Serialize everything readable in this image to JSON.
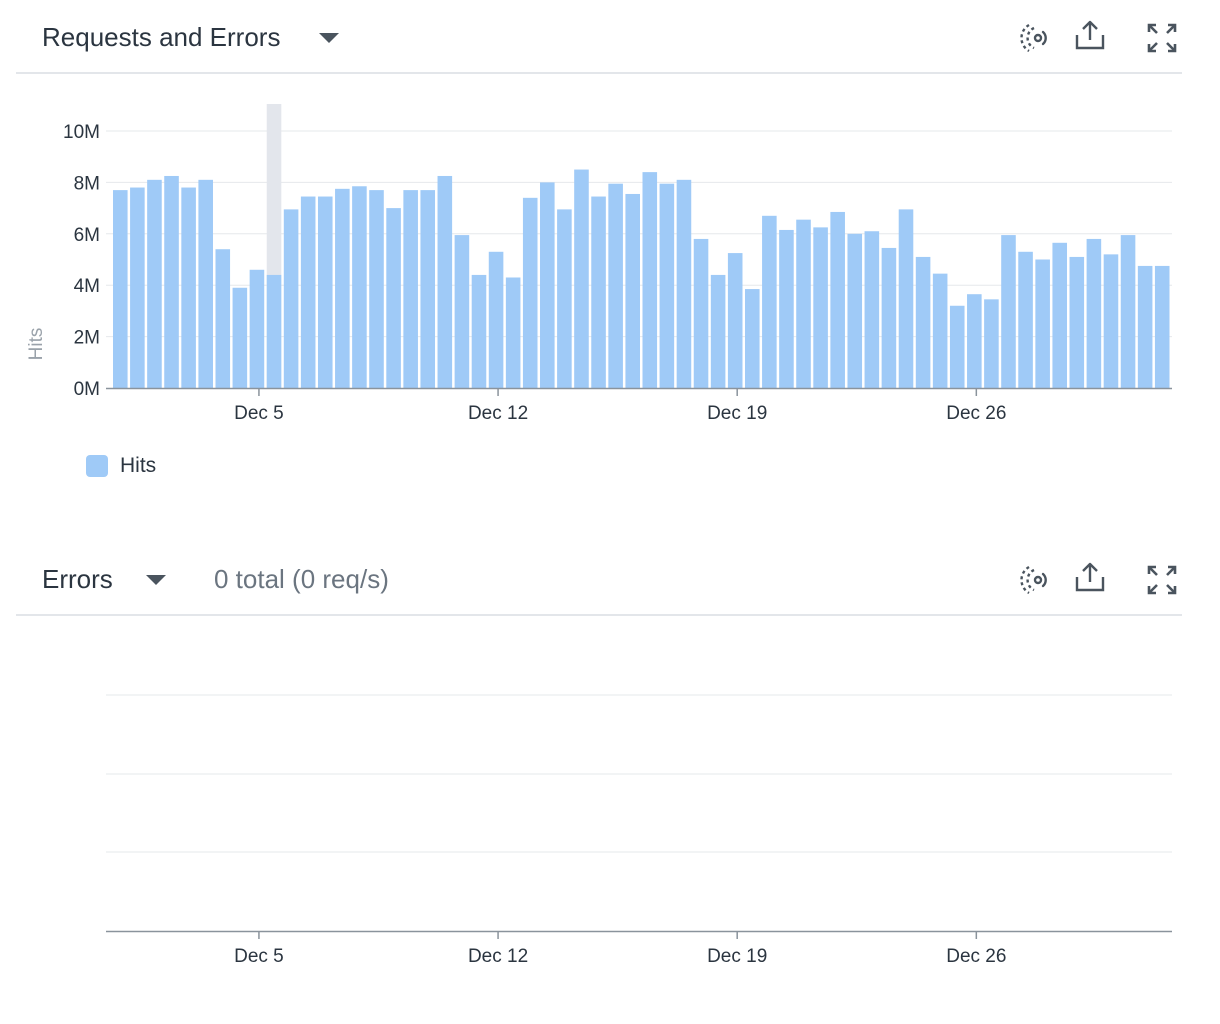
{
  "panels": {
    "requests": {
      "title": "Requests and Errors"
    },
    "errors": {
      "title": "Errors",
      "summary": "0 total (0 req/s)"
    }
  },
  "icons": {
    "live": "live-stream-icon",
    "export": "export-upload-icon",
    "expand": "expand-fullscreen-icon"
  },
  "colors": {
    "bar": "#9fcaf7",
    "highlight": "#e3e6ec",
    "grid": "#e6e8eb",
    "axis": "#8a939c"
  },
  "chart_data": [
    {
      "type": "bar",
      "ylabel": "Hits",
      "ylim": [
        0,
        10000000
      ],
      "y_ticks": [
        {
          "value": 0,
          "label": "0M"
        },
        {
          "value": 2000000,
          "label": "2M"
        },
        {
          "value": 4000000,
          "label": "4M"
        },
        {
          "value": 6000000,
          "label": "6M"
        },
        {
          "value": 8000000,
          "label": "8M"
        },
        {
          "value": 10000000,
          "label": "10M"
        }
      ],
      "x_ticks": [
        {
          "index": 8,
          "label": "Dec 5"
        },
        {
          "index": 22,
          "label": "Dec 12"
        },
        {
          "index": 36,
          "label": "Dec 19"
        },
        {
          "index": 50,
          "label": "Dec 26"
        }
      ],
      "legend": [
        {
          "name": "Hits",
          "color": "#9fcaf7"
        }
      ],
      "highlight_index": 9,
      "series": [
        {
          "name": "Hits",
          "values": [
            7700000,
            7800000,
            8100000,
            8250000,
            7800000,
            8100000,
            5400000,
            3900000,
            4600000,
            4400000,
            6950000,
            7450000,
            7450000,
            7750000,
            7850000,
            7700000,
            7000000,
            7700000,
            7700000,
            8250000,
            5950000,
            4400000,
            5300000,
            4300000,
            7400000,
            8000000,
            6950000,
            8500000,
            7450000,
            7950000,
            7550000,
            8400000,
            7950000,
            8100000,
            5800000,
            4400000,
            5250000,
            3850000,
            6700000,
            6150000,
            6550000,
            6250000,
            6850000,
            6000000,
            6100000,
            5450000,
            6950000,
            5100000,
            4450000,
            3200000,
            3650000,
            3450000,
            5950000,
            5300000,
            5000000,
            5650000,
            5100000,
            5800000,
            5200000,
            5950000,
            4750000,
            4750000
          ]
        }
      ]
    },
    {
      "type": "bar",
      "x_ticks": [
        {
          "index": 8,
          "label": "Dec 5"
        },
        {
          "index": 22,
          "label": "Dec 12"
        },
        {
          "index": 36,
          "label": "Dec 19"
        },
        {
          "index": 50,
          "label": "Dec 26"
        }
      ],
      "series": [
        {
          "values": []
        }
      ]
    }
  ]
}
